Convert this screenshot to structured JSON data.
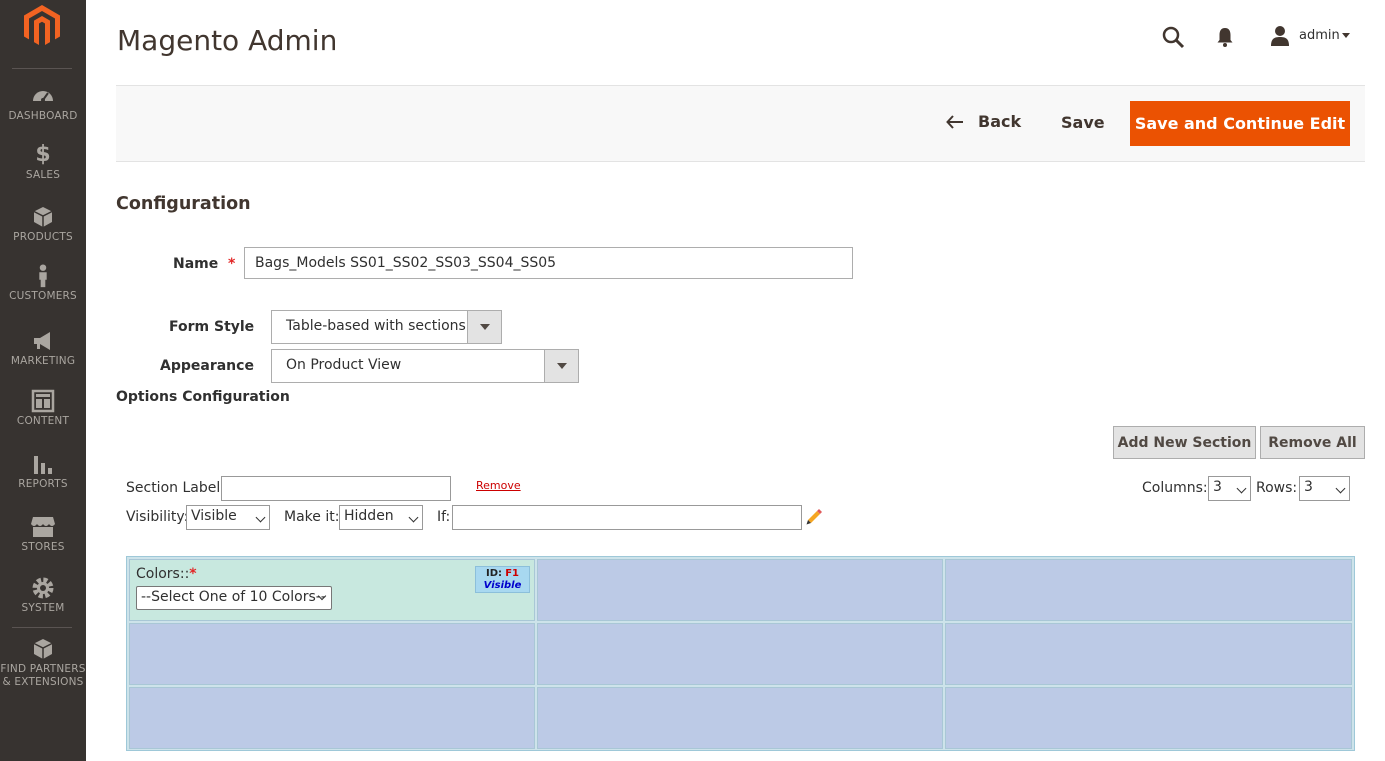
{
  "sidebar": {
    "items": [
      {
        "label": "DASHBOARD",
        "icon": "dashboard-icon"
      },
      {
        "label": "SALES",
        "icon": "dollar-icon"
      },
      {
        "label": "PRODUCTS",
        "icon": "box-icon"
      },
      {
        "label": "CUSTOMERS",
        "icon": "person-icon"
      },
      {
        "label": "MARKETING",
        "icon": "megaphone-icon"
      },
      {
        "label": "CONTENT",
        "icon": "layout-icon"
      },
      {
        "label": "REPORTS",
        "icon": "bar-chart-icon"
      },
      {
        "label": "STORES",
        "icon": "storefront-icon"
      },
      {
        "label": "SYSTEM",
        "icon": "gear-icon"
      },
      {
        "label_line1": "FIND PARTNERS",
        "label_line2": "& EXTENSIONS",
        "icon": "partners-box-icon"
      }
    ]
  },
  "header": {
    "title": "Magento Admin",
    "user": "admin"
  },
  "actions": {
    "back": "Back",
    "save": "Save",
    "save_continue": "Save and Continue Edit"
  },
  "form": {
    "section_title": "Configuration",
    "name_label": "Name",
    "required_mark": "*",
    "name_value": "Bags_Models SS01_SS02_SS03_SS04_SS05",
    "form_style_label": "Form Style",
    "form_style_value": "Table-based with sections",
    "appearance_label": "Appearance",
    "appearance_value": "On Product View",
    "options_title": "Options Configuration"
  },
  "options": {
    "add_section": "Add New Section",
    "remove_all": "Remove All",
    "section_label": "Section Label:",
    "remove": "Remove",
    "columns_label": "Columns:",
    "columns_value": "3",
    "rows_label": "Rows:",
    "rows_value": "3",
    "visibility_label": "Visibility:",
    "visibility_value": "Visible",
    "make_it_label": "Make it:",
    "make_it_value": "Hidden",
    "if_label": "If:"
  },
  "grid": {
    "field_label": "Colors::",
    "field_required": "*",
    "field_select": "--Select One of 10 Colors--",
    "id_key": "ID:",
    "id_value": "F1",
    "visibility": "Visible"
  },
  "colors": {
    "sidebar_bg": "#373330",
    "accent": "#eb5202",
    "cell_empty": "#bccae6",
    "cell_active": "#c8e8df"
  }
}
